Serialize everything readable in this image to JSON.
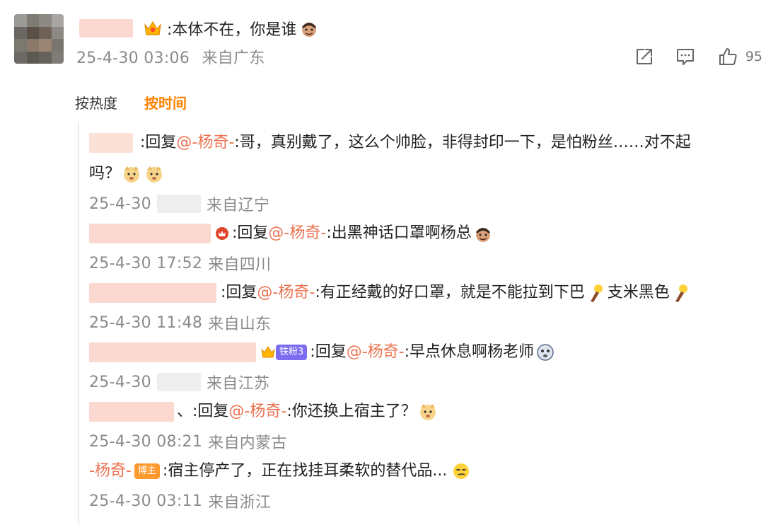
{
  "comment": {
    "text": ":本体不在，你是谁",
    "date": "25-4-30 03:06",
    "location": "来自广东",
    "like_count": "95"
  },
  "sort": {
    "hot_label": "按热度",
    "time_label": "按时间"
  },
  "replies": [
    {
      "prefix": ":回复",
      "mention": "@-杨奇-",
      "text_line1": ":哥，真别戴了，这么个帅脸，非得封印一下，是怕粉丝……对不起",
      "text_line2": "吗？",
      "date": "25-4-30",
      "location": "来自辽宁"
    },
    {
      "prefix": ":回复",
      "mention": "@-杨奇-",
      "text": ":出黑神话口罩啊杨总",
      "date": "25-4-30 17:52",
      "location": "来自四川"
    },
    {
      "prefix": ":回复",
      "mention": "@-杨奇-",
      "text_a": ":有正经戴的好口罩，就是不能拉到下巴",
      "text_b": "支米黑色",
      "date": "25-4-30 11:48",
      "location": "来自山东"
    },
    {
      "badge": "铁粉3",
      "prefix": ":回复",
      "mention": "@-杨奇-",
      "text": ":早点休息啊杨老师",
      "date": "25-4-30",
      "location": "来自江苏"
    },
    {
      "prefix": "、:回复",
      "mention": "@-杨奇-",
      "text": ":你还换上宿主了？",
      "date": "25-4-30 08:21",
      "location": "来自内蒙古"
    },
    {
      "author": "-杨奇-",
      "badge": "博主",
      "text": ":宿主停产了，正在找挂耳柔软的替代品...",
      "date": "25-4-30 03:11",
      "location": "来自浙江"
    }
  ],
  "colors": {
    "accent": "#ff8200",
    "mention": "#eb7350",
    "meta": "#8a8a8a"
  },
  "icons": [
    "share-icon",
    "comment-icon",
    "like-icon",
    "crown-icon",
    "fan-badge-icon"
  ]
}
